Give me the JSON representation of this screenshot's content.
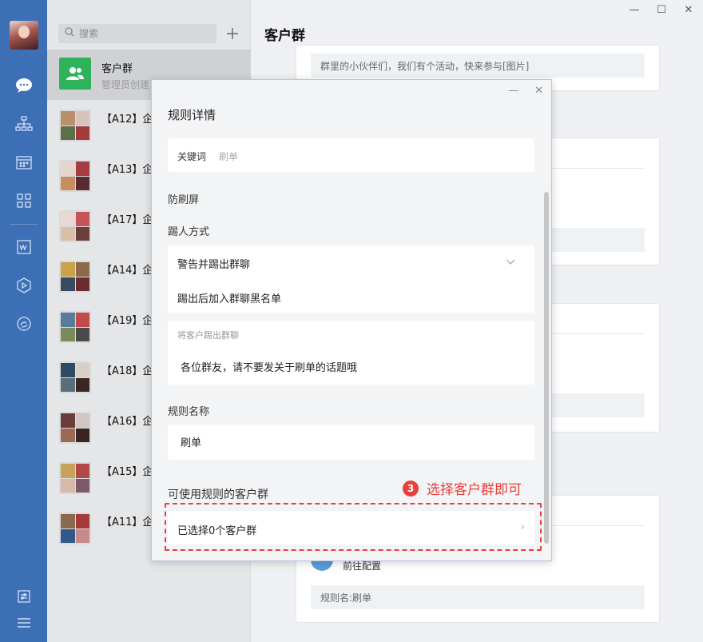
{
  "window": {
    "title": "客户群"
  },
  "search": {
    "placeholder": "搜索"
  },
  "sessions": [
    {
      "name": "客户群",
      "sub": "管理员创建了客户群规则，群规..."
    },
    {
      "name": "【A12】企"
    },
    {
      "name": "【A13】企"
    },
    {
      "name": "【A17】企"
    },
    {
      "name": "【A14】企"
    },
    {
      "name": "【A19】企"
    },
    {
      "name": "【A18】企"
    },
    {
      "name": "【A16】企"
    },
    {
      "name": "【A15】企"
    },
    {
      "name": "【A11】企"
    }
  ],
  "main": {
    "card1_text": "群里的小伙伴们，我们有个活动，快来参与[图片]",
    "card4_goto": "前往配置",
    "card4_rule": "规则名:刷单"
  },
  "dialog": {
    "title": "规则详情",
    "keyword_label": "关键词",
    "keyword_value": "刷单",
    "anti_spam": "防刷屏",
    "kick_method": "踢人方式",
    "kick_option": "警告并踢出群聊",
    "blacklist_option": "踢出后加入群聊黑名单",
    "kick_notice_label": "将客户踢出群聊",
    "kick_message": "各位群友，请不要发关于刷单的话题哦",
    "rule_name_label": "规则名称",
    "rule_name_value": "刷单",
    "groups_label": "可使用规则的客户群",
    "selected_groups": "已选择0个客户群"
  },
  "annotation": {
    "number": "3",
    "text": "选择客户群即可"
  },
  "colors": {
    "rail": "#3d6fb6",
    "accent_red": "#e8403b",
    "green": "#2fb35a"
  },
  "icons": [
    "chat-icon",
    "org-icon",
    "calendar-icon",
    "apps-icon",
    "doc-icon",
    "cube-icon",
    "cloud-icon",
    "settings-icon",
    "menu-icon"
  ]
}
